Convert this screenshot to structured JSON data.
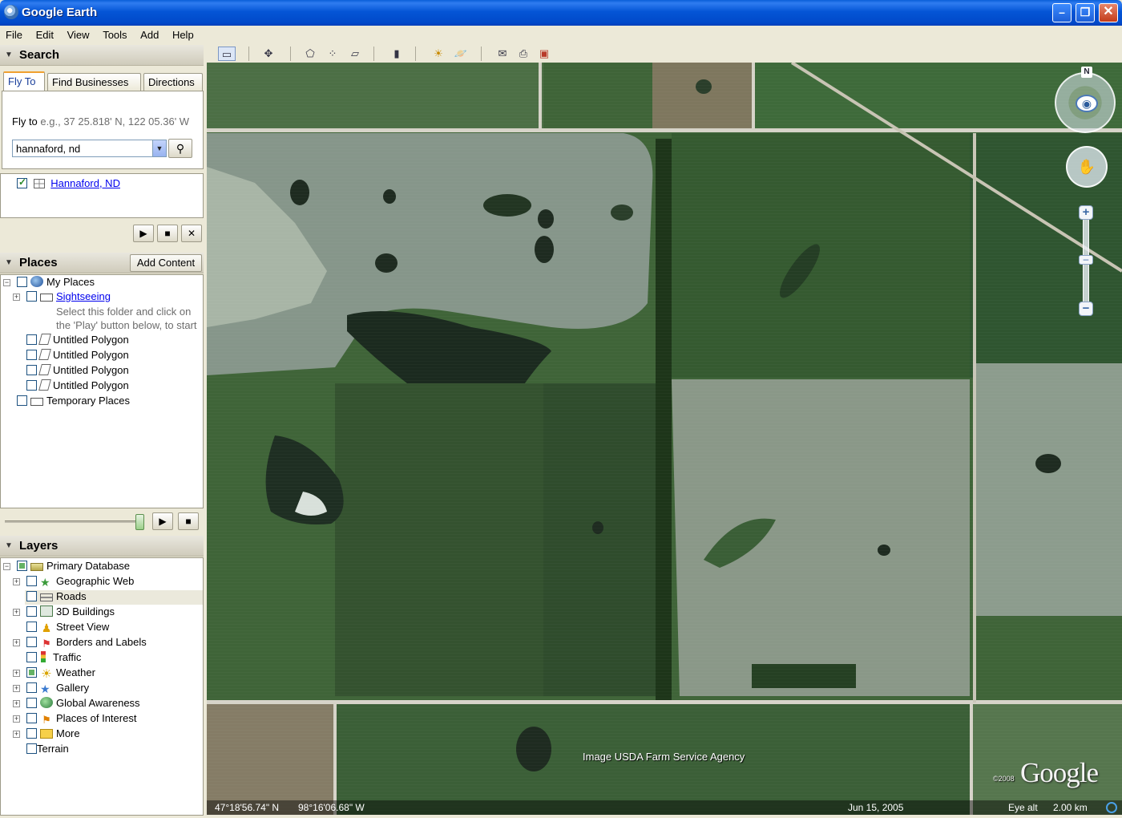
{
  "window": {
    "title": "Google Earth",
    "min_glyph": "–",
    "max_glyph": "❐",
    "close_glyph": "✕"
  },
  "menu": {
    "items": [
      "File",
      "Edit",
      "View",
      "Tools",
      "Add",
      "Help"
    ]
  },
  "search": {
    "header": "Search",
    "tabs": [
      "Fly To",
      "Find Businesses",
      "Directions"
    ],
    "active_tab": "Fly To",
    "flyto_label": "Fly to",
    "flyto_hint": "e.g., 37 25.818' N, 122 05.36' W",
    "query": "hannaford, nd",
    "result": "Hannaford, ND"
  },
  "places": {
    "header": "Places",
    "add_content": "Add Content",
    "my_places": "My Places",
    "sightseeing": "Sightseeing",
    "sightseeing_desc_1": "Select this folder and click on",
    "sightseeing_desc_2": "the 'Play' button below, to start",
    "polygons": [
      "Untitled Polygon",
      "Untitled Polygon",
      "Untitled Polygon",
      "Untitled Polygon"
    ],
    "temporary": "Temporary Places",
    "tour_slider_fraction": 0.98
  },
  "layers": {
    "header": "Layers",
    "primary": "Primary Database",
    "items": [
      "Geographic Web",
      "Roads",
      "3D Buildings",
      "Street View",
      "Borders and Labels",
      "Traffic",
      "Weather",
      "Gallery",
      "Global Awareness",
      "Places of Interest",
      "More",
      "Terrain"
    ]
  },
  "map": {
    "attribution": "Image USDA Farm Service Agency",
    "logo": "Google",
    "copyright": "©2008",
    "latitude": "47°18'56.74\" N",
    "longitude": "98°16'06.68\" W",
    "imagery_date": "Jun 15, 2005",
    "eye_alt_label": "Eye alt",
    "eye_alt_value": "2.00 km",
    "compass_north": "N"
  },
  "colors": {
    "titlebar": "#0455d6",
    "panel": "#ece9d8",
    "field_dark": "#2e4a2c",
    "field_light": "#8a9a84"
  }
}
